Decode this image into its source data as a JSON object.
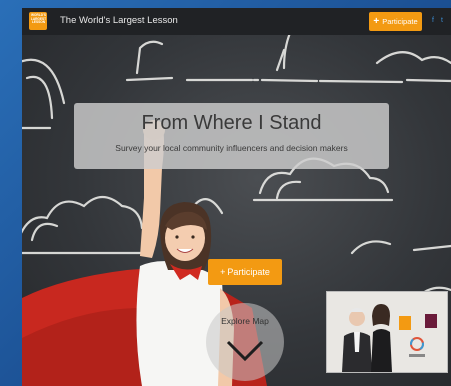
{
  "app": {
    "title": "The World's Largest Lesson",
    "logo_text": "WORLD'S LARGEST LESSON"
  },
  "header": {
    "participate_label": "Participate",
    "participate_icon": "plus-icon",
    "social_icons": [
      "facebook-icon",
      "twitter-icon"
    ]
  },
  "hero": {
    "title": "From Where I Stand",
    "subtitle": "Survey your local community influencers and decision makers",
    "participate_label": "Participate",
    "participate_icon": "plus-icon",
    "explore_label": "Explore Map",
    "explore_icon": "chevron-down-icon"
  },
  "video": {
    "badge_icon": "global-goals-icon"
  },
  "colors": {
    "accent": "#f39a12",
    "topbar": "#202225",
    "chalkboard": "#3a3d41",
    "cape": "#c8281f",
    "social": "#3b8fd6"
  }
}
